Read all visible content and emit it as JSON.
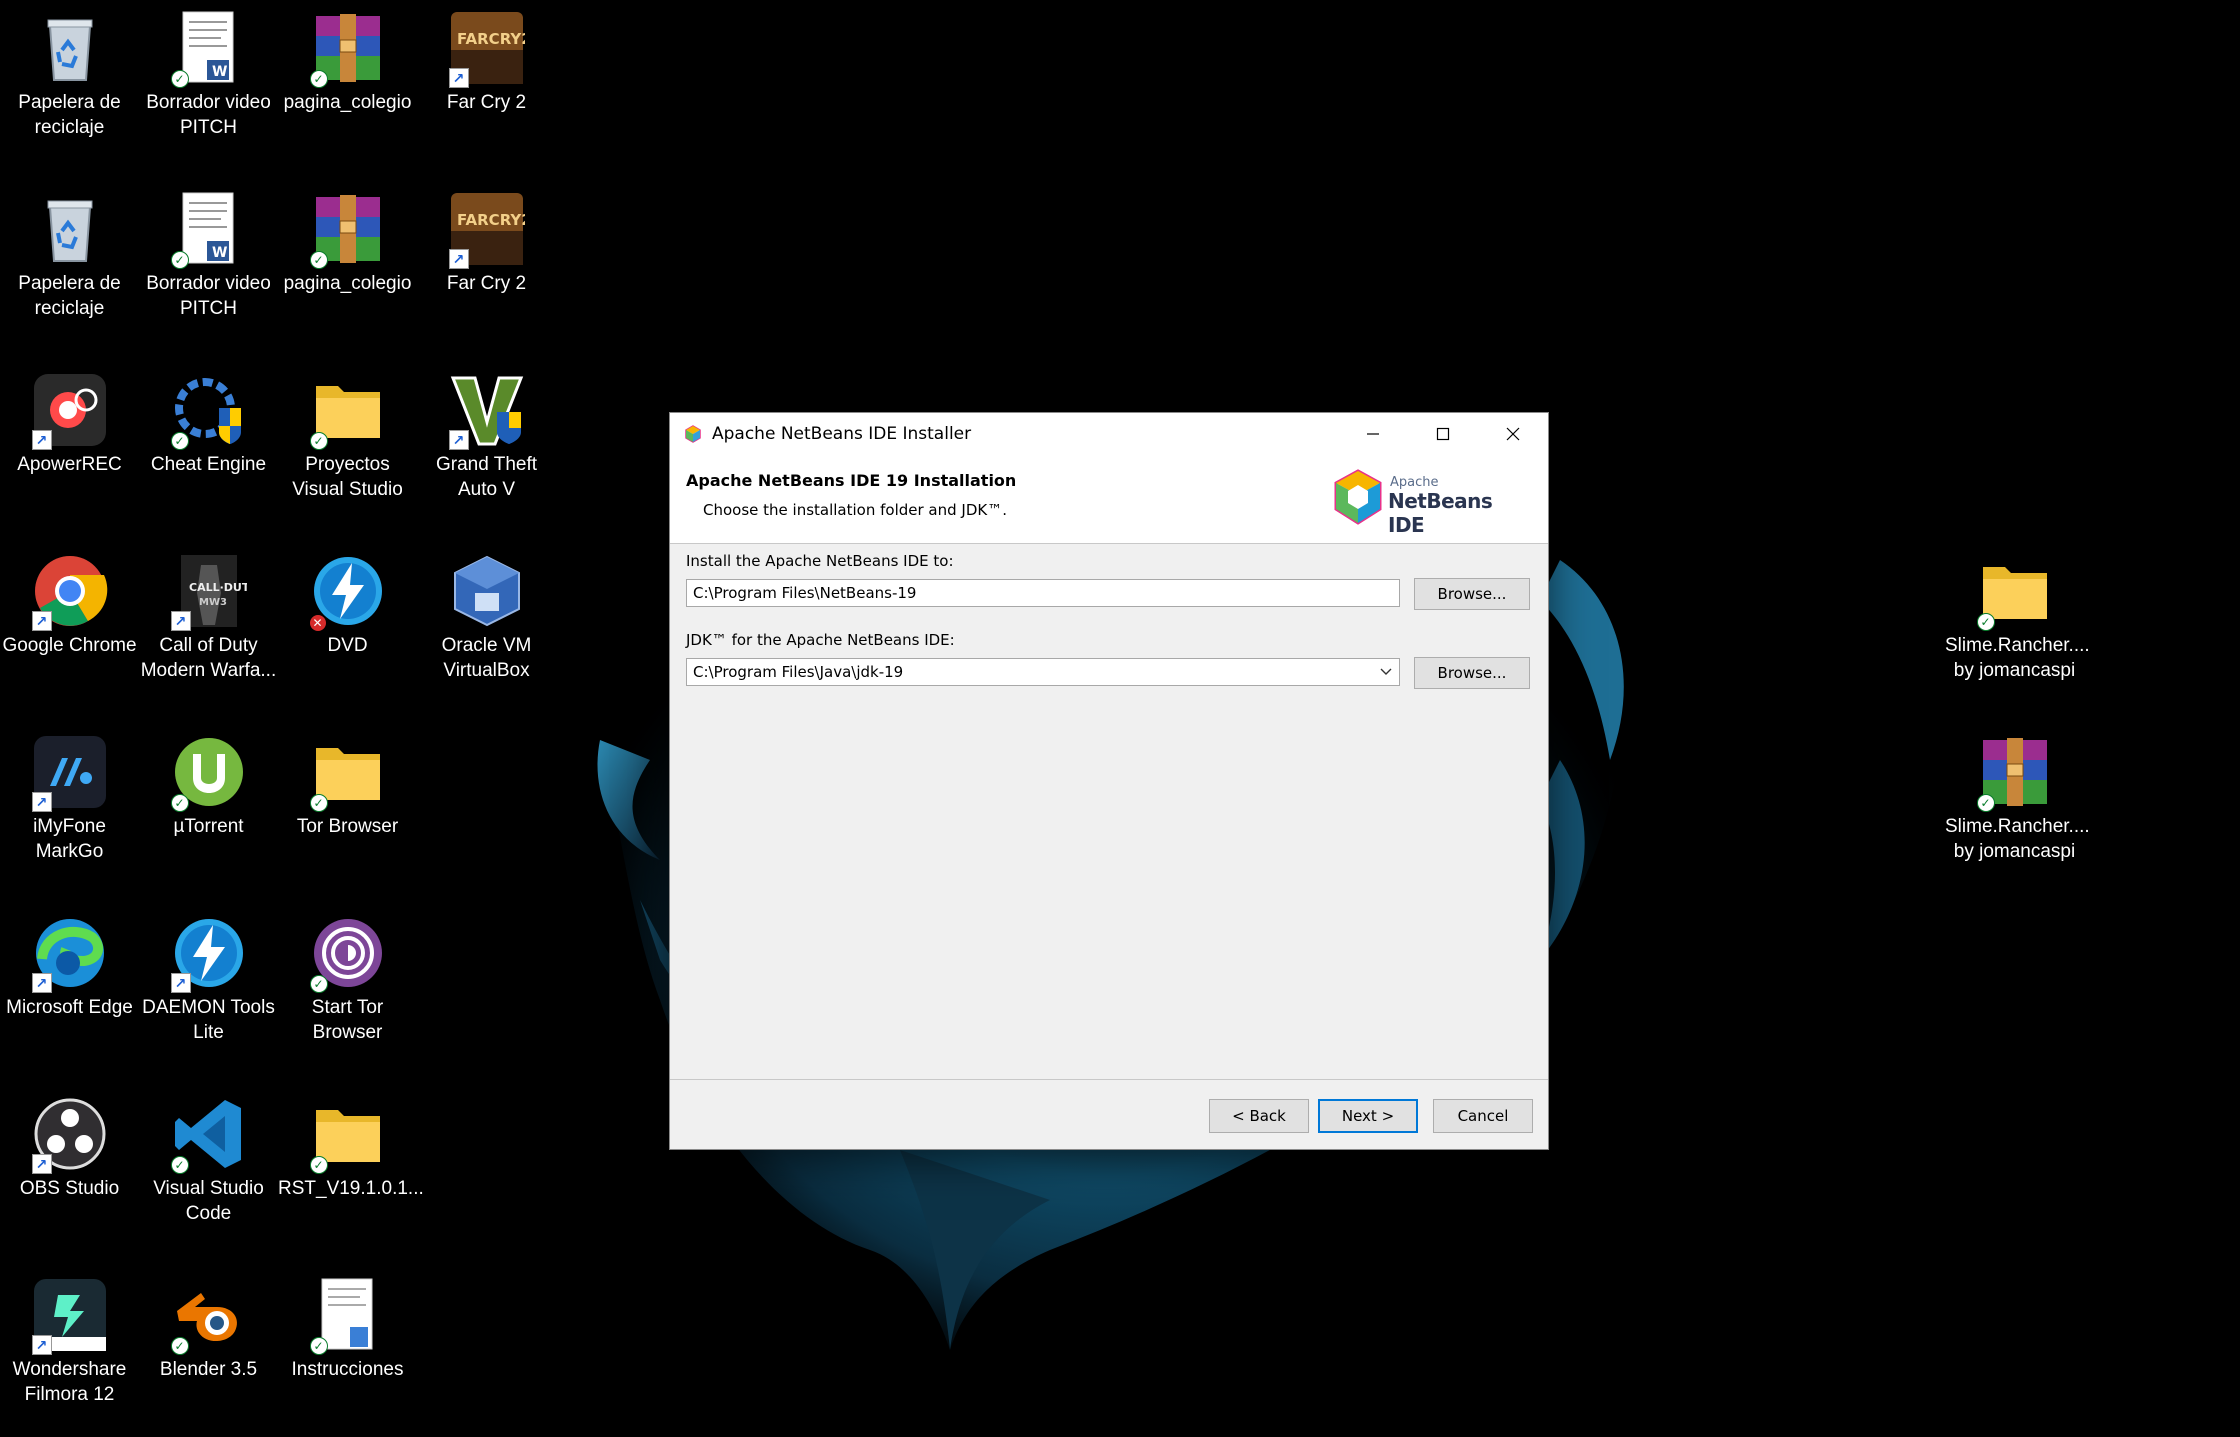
{
  "desktop": {
    "icons": [
      {
        "label": "Papelera de reciclaje",
        "icon": "recycle-bin-icon"
      },
      {
        "label": "Borrador video PITCH",
        "icon": "word-document-icon"
      },
      {
        "label": "pagina_colegio",
        "icon": "winrar-archive-icon"
      },
      {
        "label": "Far Cry 2",
        "icon": "far-cry-2-icon"
      },
      {
        "label": "Papelera de reciclaje",
        "icon": "recycle-bin-icon"
      },
      {
        "label": "Borrador video PITCH",
        "icon": "word-document-icon"
      },
      {
        "label": "pagina_colegio",
        "icon": "winrar-archive-icon"
      },
      {
        "label": "Far Cry 2",
        "icon": "far-cry-2-icon"
      },
      {
        "label": "ApowerREC",
        "icon": "apowerrec-icon"
      },
      {
        "label": "Cheat Engine",
        "icon": "cheat-engine-icon"
      },
      {
        "label": "Proyectos Visual Studio",
        "icon": "folder-icon"
      },
      {
        "label": "Grand Theft Auto V",
        "icon": "gta-v-icon"
      },
      {
        "label": "Google Chrome",
        "icon": "chrome-icon"
      },
      {
        "label": "Call of Duty Modern Warfa...",
        "icon": "call-of-duty-icon"
      },
      {
        "label": "DVD",
        "icon": "daemon-tools-icon"
      },
      {
        "label": "Oracle VM VirtualBox",
        "icon": "virtualbox-icon"
      },
      {
        "label": "iMyFone MarkGo",
        "icon": "imyfone-markgo-icon"
      },
      {
        "label": "µTorrent",
        "icon": "utorrent-icon"
      },
      {
        "label": "Tor Browser",
        "icon": "folder-icon"
      },
      {
        "label": "Microsoft Edge",
        "icon": "edge-icon"
      },
      {
        "label": "DAEMON Tools Lite",
        "icon": "daemon-tools-icon"
      },
      {
        "label": "Start Tor Browser",
        "icon": "tor-browser-icon"
      },
      {
        "label": "OBS Studio",
        "icon": "obs-studio-icon"
      },
      {
        "label": "Visual Studio Code",
        "icon": "vscode-icon"
      },
      {
        "label": "RST_V19.1.0.1...",
        "icon": "folder-icon"
      },
      {
        "label": "Wondershare Filmora 12",
        "icon": "filmora-icon"
      },
      {
        "label": "Blender 3.5",
        "icon": "blender-icon"
      },
      {
        "label": "Instrucciones",
        "icon": "notepad-document-icon"
      },
      {
        "label": "Slime.Rancher.... by jomancaspi",
        "icon": "folder-icon"
      },
      {
        "label": "Slime.Rancher.... by jomancaspi",
        "icon": "winrar-archive-icon"
      }
    ]
  },
  "installer": {
    "window_title": "Apache NetBeans IDE Installer",
    "header_title": "Apache NetBeans IDE 19 Installation",
    "header_subtitle": "Choose the installation folder and JDK™.",
    "logo_small": "Apache",
    "logo_big": "NetBeans IDE",
    "install_label": "Install the Apache NetBeans IDE to:",
    "install_path": "C:\\Program Files\\NetBeans-19",
    "jdk_label": "JDK™ for the Apache NetBeans IDE:",
    "jdk_path": "C:\\Program Files\\Java\\jdk-19",
    "browse_label": "Browse...",
    "back_label": "< Back",
    "next_label": "Next >",
    "cancel_label": "Cancel"
  }
}
